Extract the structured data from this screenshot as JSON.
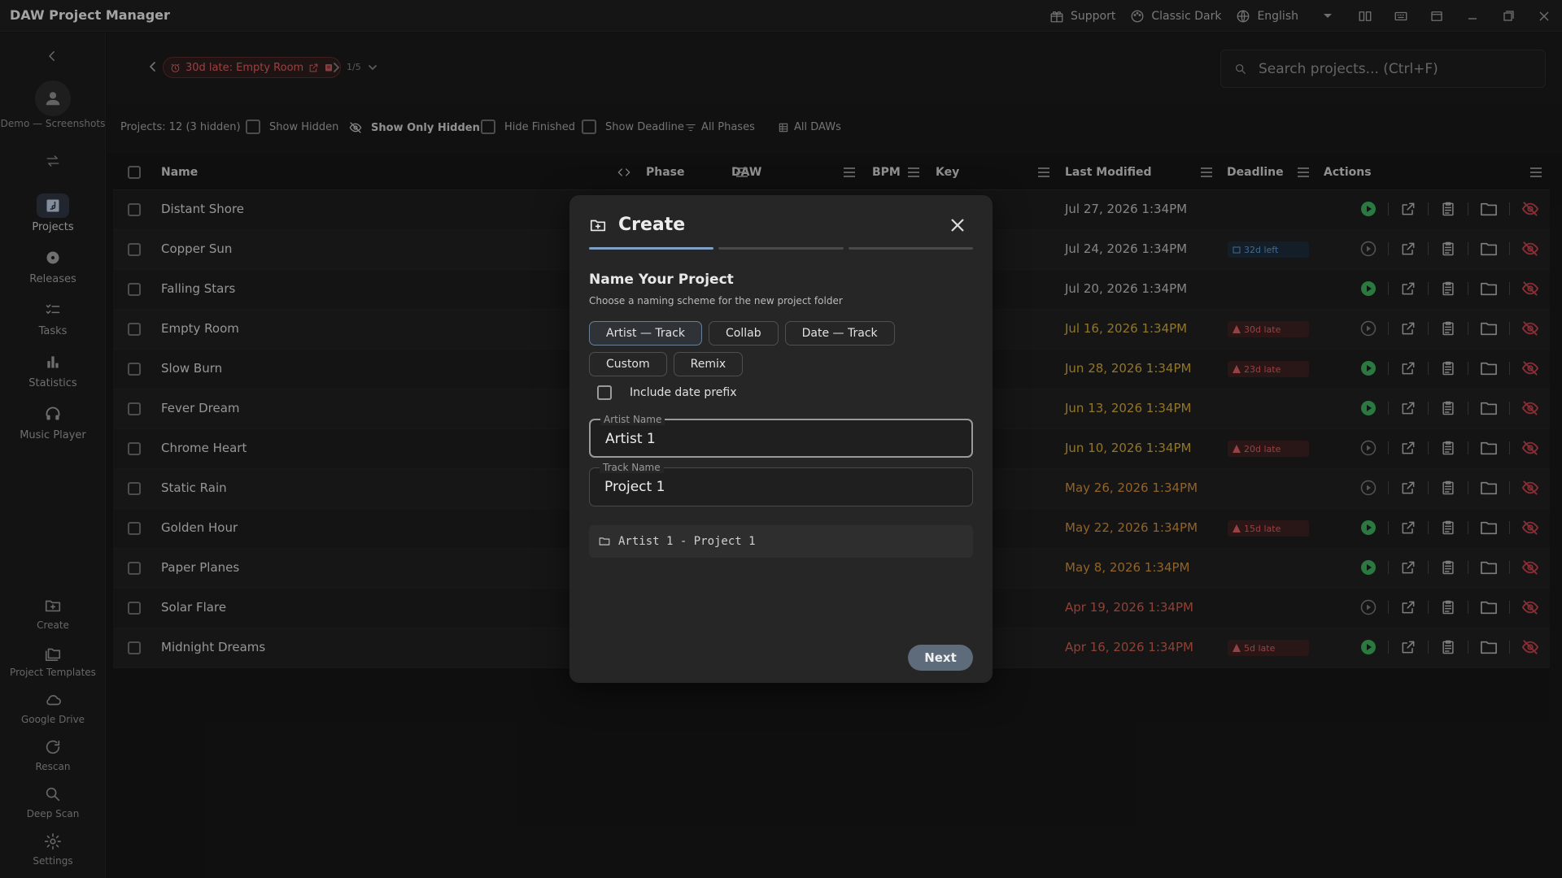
{
  "app": {
    "title": "DAW Project Manager"
  },
  "titlebar": {
    "support": "Support",
    "theme": "Classic Dark",
    "language": "English"
  },
  "sidebar": {
    "user": "Demo — Screenshots",
    "nav": [
      {
        "label": "Projects",
        "icon": "projects-icon",
        "active": true
      },
      {
        "label": "Releases",
        "icon": "disc-icon"
      },
      {
        "label": "Tasks",
        "icon": "checklist-icon"
      },
      {
        "label": "Statistics",
        "icon": "bar-chart-icon"
      },
      {
        "label": "Music Player",
        "icon": "headphones-icon"
      }
    ],
    "bottom": [
      {
        "label": "Create",
        "icon": "create-folder-icon"
      },
      {
        "label": "Project Templates",
        "icon": "templates-icon"
      },
      {
        "label": "Google Drive",
        "icon": "cloud-icon"
      },
      {
        "label": "Rescan",
        "icon": "refresh-icon"
      },
      {
        "label": "Deep Scan",
        "icon": "search-icon"
      },
      {
        "label": "Settings",
        "icon": "gear-icon"
      }
    ]
  },
  "topbar": {
    "crumb": "30d late: Empty Room",
    "pager": "1/5",
    "search_placeholder": "Search projects... (Ctrl+F)"
  },
  "filters": {
    "count": "Projects: 12 (3 hidden)",
    "show_hidden": "Show Hidden",
    "show_only_hidden": "Show Only Hidden",
    "hide_finished": "Hide Finished",
    "show_deadline": "Show Deadline",
    "phases": "All Phases",
    "daws": "All DAWs"
  },
  "table": {
    "headers": {
      "name": "Name",
      "phase": "Phase",
      "daw": "DAW",
      "bpm": "BPM",
      "key": "Key",
      "last_modified": "Last Modified",
      "deadline": "Deadline",
      "actions": "Actions"
    },
    "rows": [
      {
        "name": "Distant Shore",
        "date": "Jul 27, 2026 1:34PM",
        "date_color": "#b9b9b9",
        "deadline": "",
        "deadline_type": "",
        "play": true
      },
      {
        "name": "Copper Sun",
        "date": "Jul 24, 2026 1:34PM",
        "date_color": "#b9b9b9",
        "deadline": "32d left",
        "deadline_type": "left",
        "play": false
      },
      {
        "name": "Falling Stars",
        "date": "Jul 20, 2026 1:34PM",
        "date_color": "#b9b9b9",
        "deadline": "",
        "deadline_type": "",
        "play": true
      },
      {
        "name": "Empty Room",
        "date": "Jul 16, 2026 1:34PM",
        "date_color": "#c9a23a",
        "deadline": "30d late",
        "deadline_type": "late",
        "play": false
      },
      {
        "name": "Slow Burn",
        "date": "Jun 28, 2026 1:34PM",
        "date_color": "#c9a23a",
        "deadline": "23d late",
        "deadline_type": "late",
        "play": true
      },
      {
        "name": "Fever Dream",
        "date": "Jun 13, 2026 1:34PM",
        "date_color": "#c9a23a",
        "deadline": "",
        "deadline_type": "",
        "play": true
      },
      {
        "name": "Chrome Heart",
        "date": "Jun 10, 2026 1:34PM",
        "date_color": "#c9a23a",
        "deadline": "20d late",
        "deadline_type": "late",
        "play": false
      },
      {
        "name": "Static Rain",
        "date": "May 26, 2026 1:34PM",
        "date_color": "#c9893a",
        "deadline": "",
        "deadline_type": "",
        "play": false
      },
      {
        "name": "Golden Hour",
        "date": "May 22, 2026 1:34PM",
        "date_color": "#c9893a",
        "deadline": "15d late",
        "deadline_type": "late",
        "play": true
      },
      {
        "name": "Paper Planes",
        "date": "May 8, 2026 1:34PM",
        "date_color": "#c9893a",
        "deadline": "",
        "deadline_type": "",
        "play": true
      },
      {
        "name": "Solar Flare",
        "date": "Apr 19, 2026 1:34PM",
        "date_color": "#c85a4a",
        "deadline": "",
        "deadline_type": "",
        "play": false
      },
      {
        "name": "Midnight Dreams",
        "date": "Apr 16, 2026 1:34PM",
        "date_color": "#c85a4a",
        "deadline": "5d late",
        "deadline_type": "late",
        "play": true
      }
    ]
  },
  "modal": {
    "title": "Create",
    "step_active": 1,
    "step_total": 3,
    "heading": "Name Your Project",
    "subheading": "Choose a naming scheme for the new project folder",
    "options": [
      "Artist — Track",
      "Collab",
      "Date — Track",
      "Custom",
      "Remix"
    ],
    "selected_option": "Artist — Track",
    "include_date_label": "Include date prefix",
    "artist_label": "Artist Name",
    "artist_value": "Artist 1",
    "track_label": "Track Name",
    "track_value": "Project 1",
    "preview": "Artist 1 - Project 1",
    "next": "Next"
  },
  "colors": {
    "accent": "#7f9fc4",
    "late": "#d25c5c",
    "play": "#3aa85a"
  }
}
